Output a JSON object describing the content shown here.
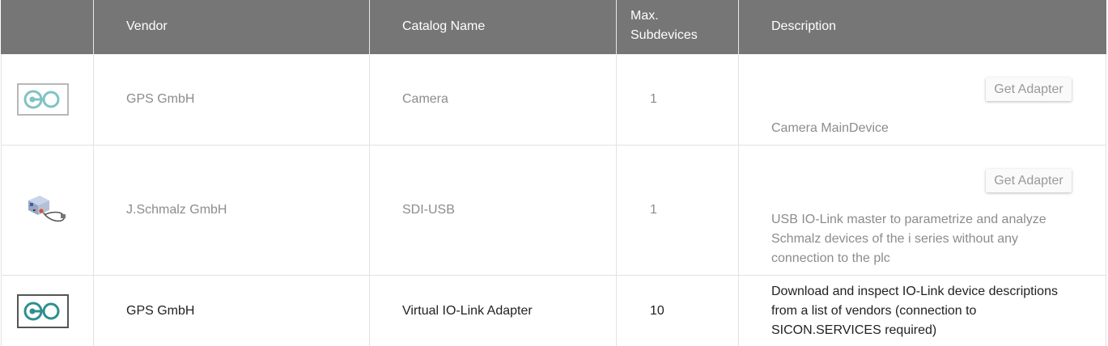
{
  "columns": {
    "vendor": "Vendor",
    "catalog": "Catalog Name",
    "max_line1": "Max.",
    "max_line2": "Subdevices",
    "description": "Description"
  },
  "rows": [
    {
      "icon": "gps-logo-icon",
      "vendor": "GPS GmbH",
      "catalog": "Camera",
      "max": "1",
      "button": "Get Adapter",
      "description": "Camera MainDevice",
      "enabled": false
    },
    {
      "icon": "usb-adapter-icon",
      "vendor": "J.Schmalz GmbH",
      "catalog": "SDI-USB",
      "max": "1",
      "button": "Get Adapter",
      "description_lines": [
        "USB IO-Link master to parametrize and analyze",
        "Schmalz devices of the i series without any",
        "connection to the plc"
      ],
      "enabled": false
    },
    {
      "icon": "gps-logo-icon",
      "vendor": "GPS GmbH",
      "catalog": "Virtual IO-Link Adapter",
      "max": "10",
      "description_lines": [
        "Download and inspect IO-Link device descriptions",
        "from a list of vendors (connection to",
        "SICON.SERVICES required)"
      ],
      "enabled": true
    }
  ],
  "colors": {
    "header_bg": "#767676",
    "header_text": "#ffffff",
    "disabled_text": "#8c8c8c",
    "enabled_text": "#222222",
    "logo_teal_light": "#7fc3c3",
    "logo_teal": "#2e8f8f",
    "grid": "#e2e2e2"
  }
}
